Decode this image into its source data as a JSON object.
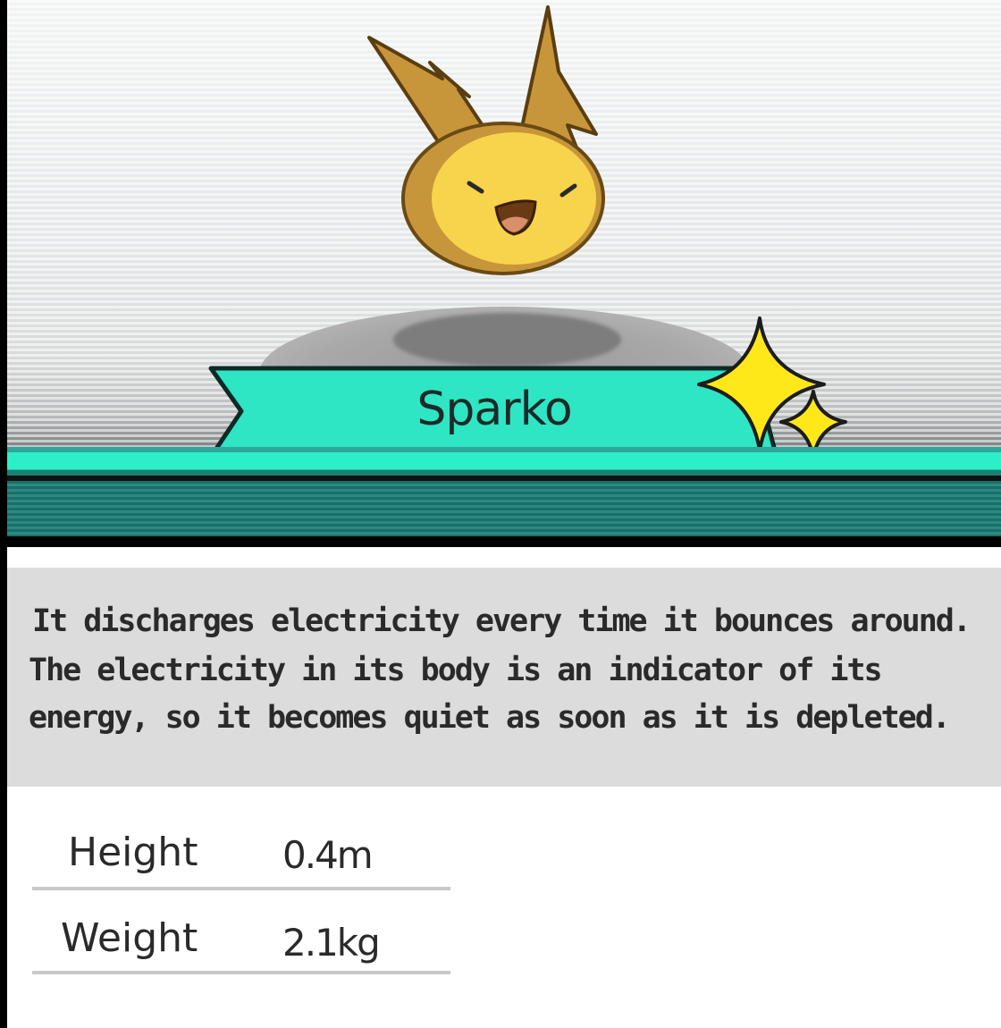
{
  "creature": {
    "name": "Sparko",
    "sprite_icon": "electric-blob-creature-icon",
    "shiny_icon": "sparkle-stars-icon"
  },
  "description": {
    "lines": [
      "It discharges electricity every time it bounces around.",
      "The electricity in its body is an indicator of its",
      "energy, so it becomes quiet as soon as it is depleted."
    ]
  },
  "stats": {
    "height_label": "Height",
    "height_value": "0.4m",
    "weight_label": "Weight",
    "weight_value": "2.1kg"
  },
  "colors": {
    "banner": "#2ee6c4",
    "sparkle": "#ffe81a",
    "body": "#f7d44a",
    "fur": "#c49a3c"
  }
}
